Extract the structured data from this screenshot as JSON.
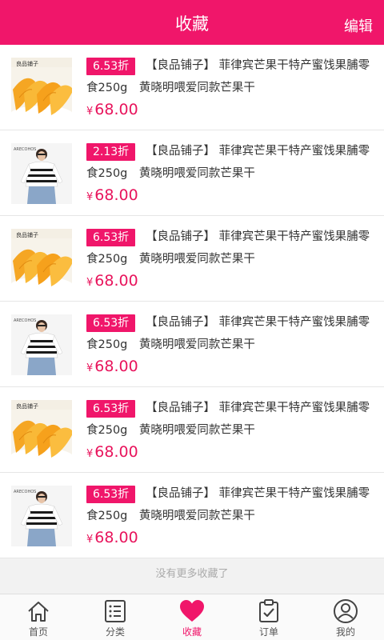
{
  "header": {
    "title": "收藏",
    "edit_label": "编辑"
  },
  "items": [
    {
      "discount": "6.53折",
      "name": "【良品铺子】 菲律宾芒果干特产蜜饯果脯零食250g　黄晓明喂爱同款芒果干",
      "currency": "¥",
      "price": "68.00",
      "image": "mango"
    },
    {
      "discount": "2.13折",
      "name": "【良品铺子】 菲律宾芒果干特产蜜饯果脯零食250g　黄晓明喂爱同款芒果干",
      "currency": "¥",
      "price": "68.00",
      "image": "sweater"
    },
    {
      "discount": "6.53折",
      "name": "【良品铺子】 菲律宾芒果干特产蜜饯果脯零食250g　黄晓明喂爱同款芒果干",
      "currency": "¥",
      "price": "68.00",
      "image": "mango"
    },
    {
      "discount": "6.53折",
      "name": "【良品铺子】 菲律宾芒果干特产蜜饯果脯零食250g　黄晓明喂爱同款芒果干",
      "currency": "¥",
      "price": "68.00",
      "image": "sweater"
    },
    {
      "discount": "6.53折",
      "name": "【良品铺子】 菲律宾芒果干特产蜜饯果脯零食250g　黄晓明喂爱同款芒果干",
      "currency": "¥",
      "price": "68.00",
      "image": "mango"
    },
    {
      "discount": "6.53折",
      "name": "【良品铺子】 菲律宾芒果干特产蜜饯果脯零食250g　黄晓明喂爱同款芒果干",
      "currency": "¥",
      "price": "68.00",
      "image": "sweater"
    }
  ],
  "footer_note": "没有更多收藏了",
  "tabs": [
    {
      "label": "首页",
      "icon": "home-icon",
      "active": false
    },
    {
      "label": "分类",
      "icon": "category-list-icon",
      "active": false
    },
    {
      "label": "收藏",
      "icon": "heart-icon",
      "active": true
    },
    {
      "label": "订单",
      "icon": "order-clipboard-icon",
      "active": false
    },
    {
      "label": "我的",
      "icon": "user-icon",
      "active": false
    }
  ],
  "colors": {
    "brand": "#f0166a",
    "price": "#e8145c"
  }
}
